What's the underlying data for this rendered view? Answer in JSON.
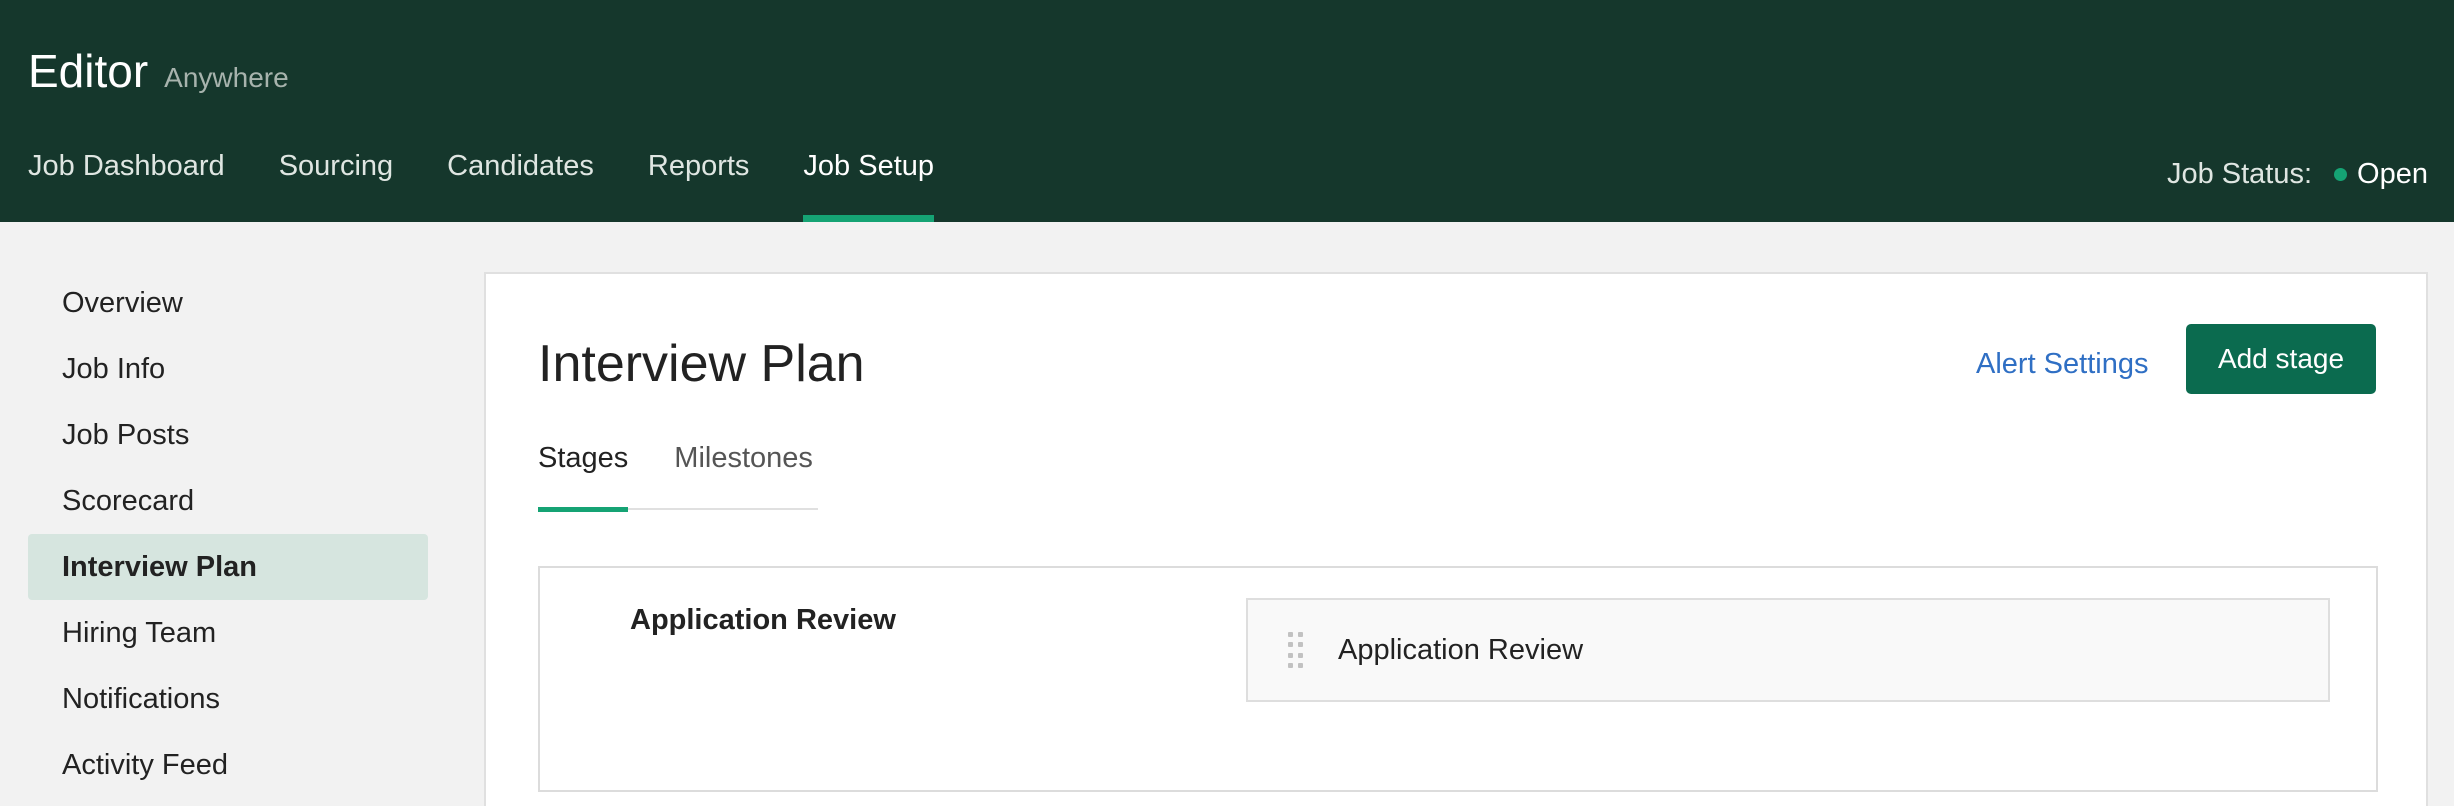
{
  "header": {
    "title": "Editor",
    "subtitle": "Anywhere",
    "nav": [
      {
        "label": "Job Dashboard"
      },
      {
        "label": "Sourcing"
      },
      {
        "label": "Candidates"
      },
      {
        "label": "Reports"
      },
      {
        "label": "Job Setup",
        "active": true
      }
    ],
    "job_status_label": "Job Status:",
    "job_status_value": "Open"
  },
  "sidebar": {
    "items": [
      {
        "label": "Overview"
      },
      {
        "label": "Job Info"
      },
      {
        "label": "Job Posts"
      },
      {
        "label": "Scorecard"
      },
      {
        "label": "Interview Plan",
        "active": true
      },
      {
        "label": "Hiring Team"
      },
      {
        "label": "Notifications"
      },
      {
        "label": "Activity Feed"
      }
    ]
  },
  "main": {
    "title": "Interview Plan",
    "alert_settings_label": "Alert Settings",
    "add_stage_label": "Add stage",
    "tabs": [
      {
        "label": "Stages",
        "active": true
      },
      {
        "label": "Milestones"
      }
    ],
    "stages": [
      {
        "name": "Application Review",
        "interviews": [
          {
            "name": "Application Review"
          }
        ]
      }
    ]
  },
  "colors": {
    "header_bg": "#15372c",
    "accent": "#15a374",
    "primary_button": "#0b6b4f",
    "link": "#2f6fc4",
    "sidebar_active_bg": "#d6e5df"
  },
  "icons": {
    "status": "status-dot-icon",
    "drag": "drag-handle-icon"
  }
}
